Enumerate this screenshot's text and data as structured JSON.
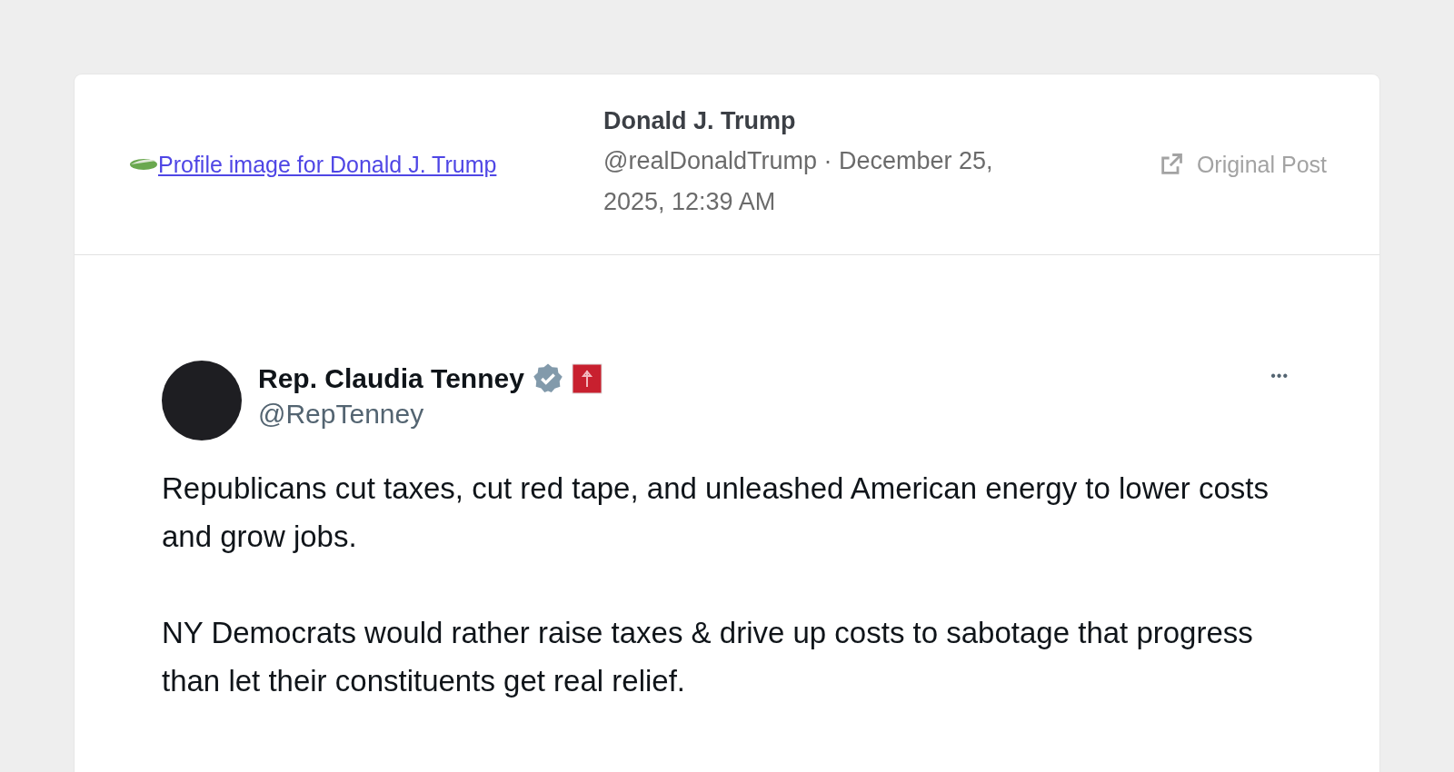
{
  "post": {
    "image_alt": "Profile image for Donald J. Trump",
    "author": "Donald J. Trump",
    "handle": "@realDonaldTrump",
    "separator": "·",
    "date": "December 25, 2025, 12:39 AM",
    "original_link": "Original Post"
  },
  "embedded_tweet": {
    "name": "Rep. Claudia Tenney",
    "verified": true,
    "handle": "@RepTenney",
    "more": "•••",
    "paragraphs": [
      "Republicans cut taxes, cut red tape, and unleashed American energy to lower costs and grow jobs.",
      "NY Democrats would rather raise taxes & drive up costs to sabotage that progress than let their constituents get real relief."
    ]
  }
}
